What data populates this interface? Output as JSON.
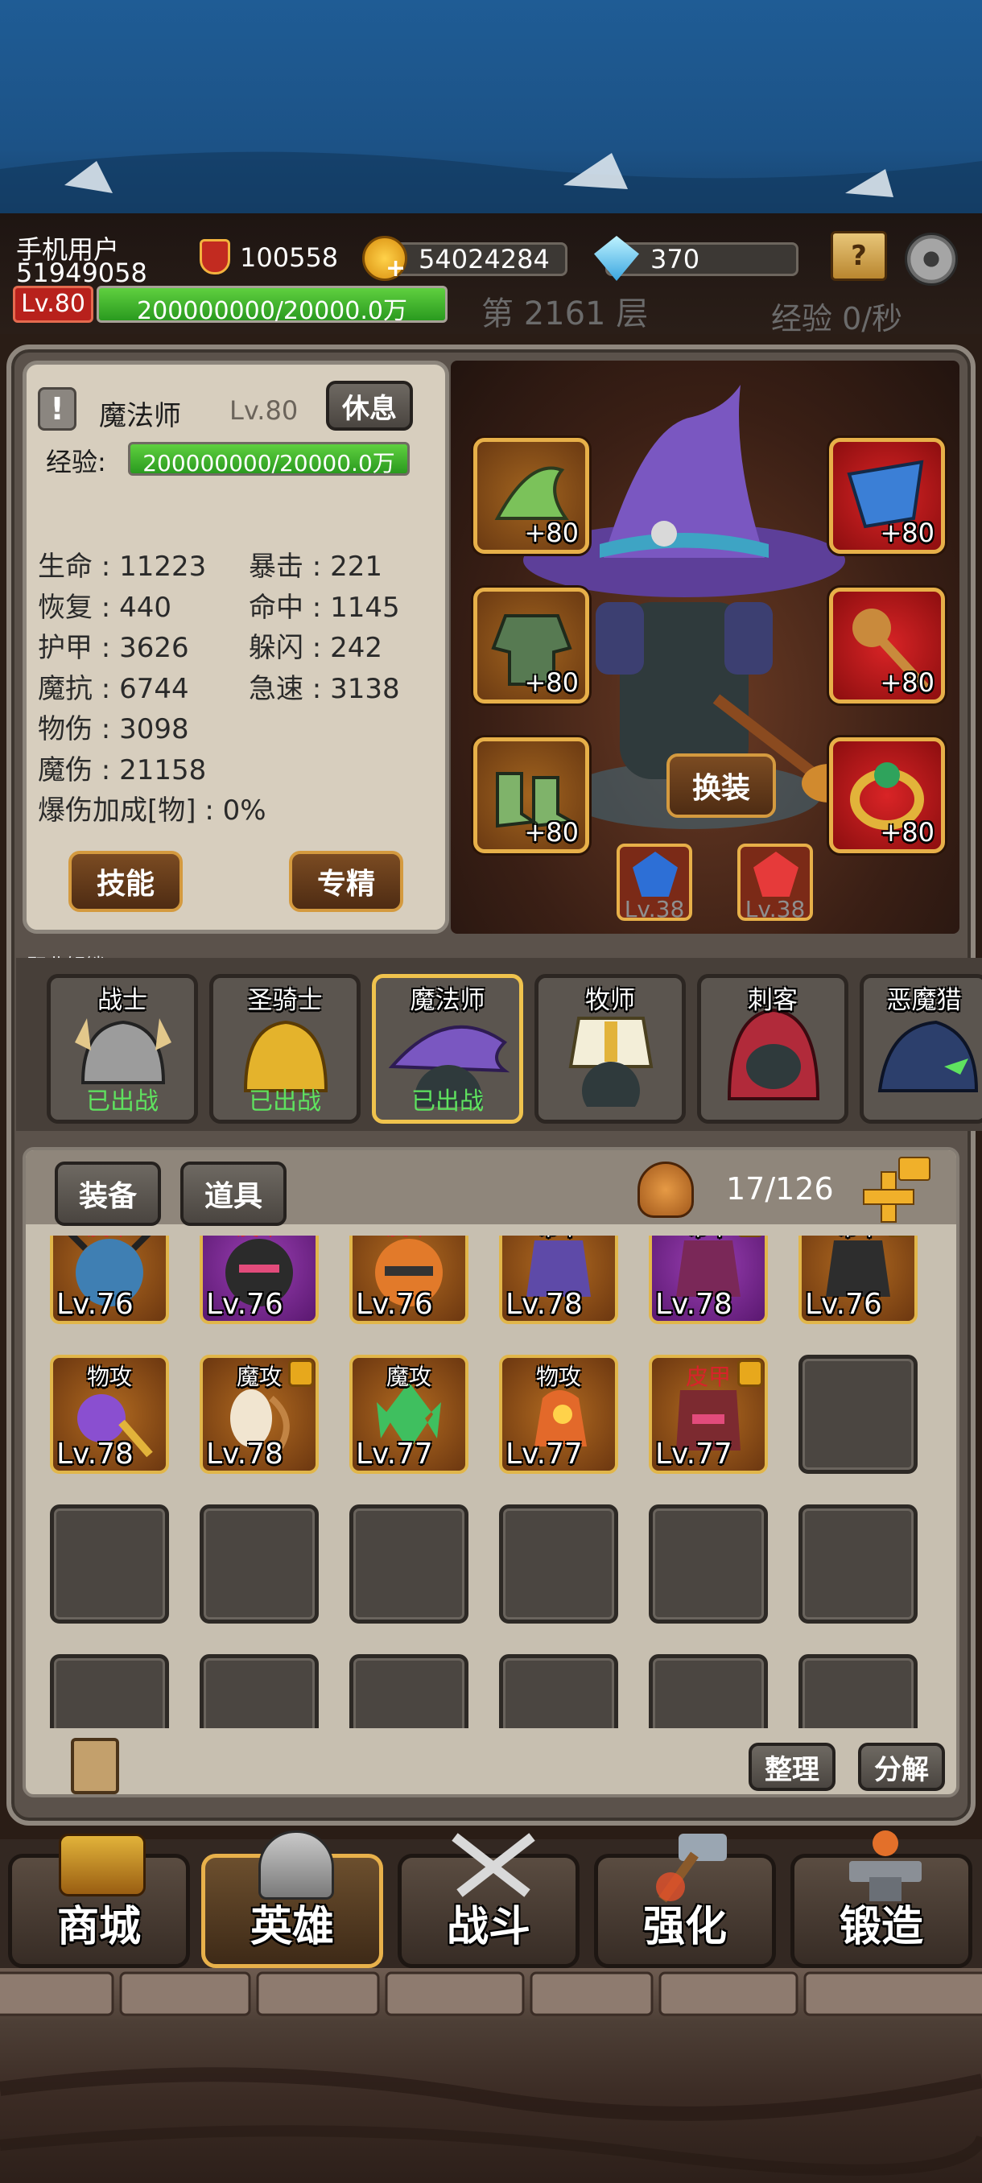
{
  "header": {
    "username": "手机用户",
    "user_id": "51949058",
    "level": "Lv.80",
    "xp_bar": "200000000/20000.0万",
    "power": "100558",
    "gold": "54024284",
    "gems": "370",
    "floor": "第 2161 层",
    "xp_rate": "经验 0/秒"
  },
  "hero": {
    "class_name": "魔法师",
    "level": "Lv.80",
    "rest_button": "休息",
    "xp_label": "经验:",
    "xp_value": "200000000/20000.0万",
    "stats_left": [
      "生命 : 11223",
      "恢复 : 440",
      "护甲 : 3626",
      "魔抗 : 6744",
      "物伤 : 3098",
      "魔伤 : 21158",
      "爆伤加成[物] : 0%"
    ],
    "stats_right": [
      "暴击 : 221",
      "命中 : 1145",
      "躲闪 : 242",
      "急速 : 3138"
    ],
    "skills_button": "技能",
    "specialize_button": "专精"
  },
  "equipment": {
    "left_slots": [
      "+80",
      "+80",
      "+80"
    ],
    "right_slots": [
      "+80",
      "+80",
      "+80"
    ],
    "swap_button": "换装",
    "gems": [
      "Lv.38",
      "Lv.38"
    ]
  },
  "classes": {
    "title": "职业解锁",
    "items": [
      {
        "name": "战士",
        "status": "已出战"
      },
      {
        "name": "圣骑士",
        "status": "已出战"
      },
      {
        "name": "魔法师",
        "status": "已出战"
      },
      {
        "name": "牧师",
        "status": ""
      },
      {
        "name": "刺客",
        "status": ""
      },
      {
        "name": "恶魔猎",
        "status": ""
      }
    ]
  },
  "inventory": {
    "tab_equipment": "装备",
    "tab_items": "道具",
    "capacity": "17/126",
    "row1": [
      {
        "tag": "皮甲",
        "level": "Lv.76"
      },
      {
        "tag": "皮甲",
        "level": "Lv.76"
      },
      {
        "tag": "皮甲",
        "level": "Lv.76"
      },
      {
        "tag": "布甲",
        "level": "Lv.78"
      },
      {
        "tag": "布甲",
        "level": "Lv.78"
      },
      {
        "tag": "布甲",
        "level": "Lv.76"
      }
    ],
    "row2": [
      {
        "tag": "物攻",
        "level": "Lv.78"
      },
      {
        "tag": "魔攻",
        "level": "Lv.78"
      },
      {
        "tag": "魔攻",
        "level": "Lv.77"
      },
      {
        "tag": "物攻",
        "level": "Lv.77"
      },
      {
        "tag": "皮甲",
        "level": "Lv.77"
      }
    ],
    "sort_button": "整理",
    "dismantle_button": "分解"
  },
  "nav": {
    "shop": "商城",
    "hero": "英雄",
    "battle": "战斗",
    "enhance": "强化",
    "forge": "锻造"
  }
}
